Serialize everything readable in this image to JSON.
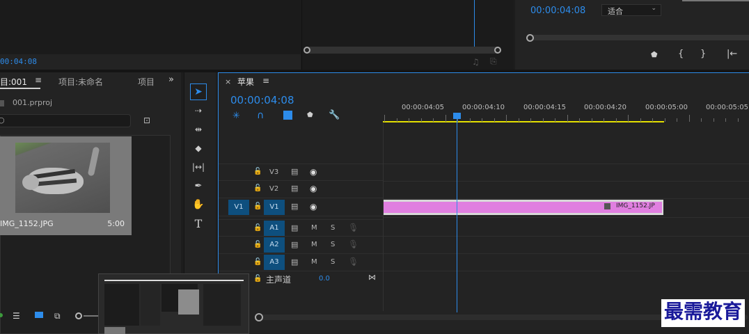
{
  "source_monitor": {
    "timecode_left": "00:04:08"
  },
  "program_monitor": {
    "timecode": "00:00:04:08",
    "fit_label": "适合",
    "buttons": [
      "marker-icon",
      "in-point-icon",
      "out-point-icon",
      "go-to-in-icon"
    ]
  },
  "project_panel": {
    "tab_project": "目:001",
    "tab_unnamed": "项目:未命名",
    "tab_more": "项目",
    "file_name": "001.prproj",
    "search_placeholder": "",
    "clip_name": "IMG_1152.JPG",
    "clip_duration": "5:00"
  },
  "timeline": {
    "close": "×",
    "sequence_name": "苹果",
    "timecode": "00:00:04:08",
    "ruler_labels": [
      "00:00:04:05",
      "00:00:04:10",
      "00:00:04:15",
      "00:00:04:20",
      "00:00:05:00",
      "00:00:05:05"
    ],
    "tracks": {
      "v3": "V3",
      "v2": "V2",
      "v1_src": "V1",
      "v1": "V1",
      "a1": "A1",
      "a2": "A2",
      "a3": "A3",
      "m": "M",
      "s": "S",
      "master_label": "主声道",
      "master_value": "0.0"
    },
    "clip_label": "IMG_1152.JP"
  },
  "watermark": "最需教育",
  "colors": {
    "accent_blue": "#2d8ceb",
    "clip_pink": "#e07fe0",
    "work_area_yellow": "#e4e000",
    "track_blue": "#0e4f7e"
  }
}
